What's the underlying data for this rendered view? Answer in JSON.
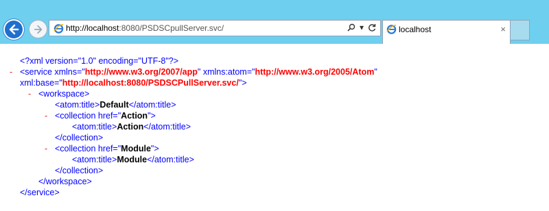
{
  "browser": {
    "url_host": "http://localhost",
    "url_rest": ":8080/PSDSCpullServer.svc/",
    "tab_title": "localhost",
    "tab_close": "×",
    "search_glyph": "⚲",
    "dropdown_glyph": "▾",
    "refresh_glyph": "C",
    "icons": [
      "back-arrow-icon",
      "forward-arrow-icon",
      "ie-logo-icon",
      "search-icon",
      "refresh-icon",
      "close-icon"
    ],
    "colors": {
      "titlebar": "#6fcfee",
      "back_button": "#1e6fcf"
    }
  },
  "xml": {
    "decl": "<?xml version=\"1.0\" encoding=\"UTF-8\"?>",
    "minus": "-",
    "service_open_a": "<service xmlns=\"",
    "service_xmlns": "http://www.w3.org/2007/app",
    "service_open_b": "\" xmlns:atom=\"",
    "service_atom": "http://www.w3.org/2005/Atom",
    "service_open_c": "\"",
    "base_a": "xml:base=\"",
    "base_val": "http://localhost:8080/PSDSCPullServer.svc/",
    "base_b": "\">",
    "ws_open": "<workspace>",
    "atom_title_open": "<atom:title>",
    "atom_title_close": "</atom:title>",
    "default_title": "Default",
    "coll_open_a": "<collection href=\"",
    "coll_open_b": "\">",
    "action": "Action",
    "module": "Module",
    "coll_close": "</collection>",
    "ws_close": "</workspace>",
    "service_close": "</service>"
  }
}
